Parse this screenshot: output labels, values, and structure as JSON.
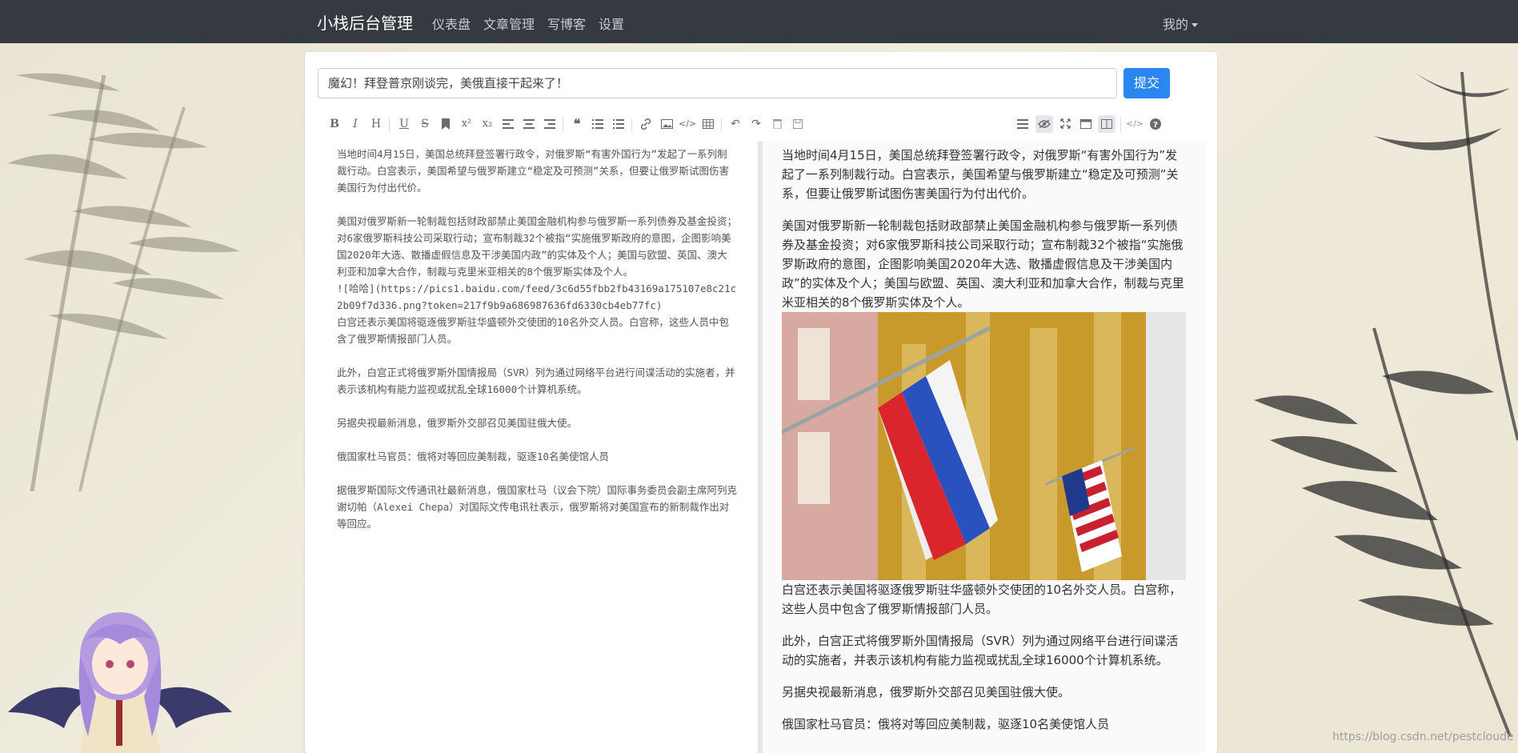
{
  "navbar": {
    "brand": "小栈后台管理",
    "links": [
      "仪表盘",
      "文章管理",
      "写博客",
      "设置"
    ],
    "user_menu": "我的"
  },
  "editor": {
    "title_value": "魔幻！拜登普京刚谈完，美俄直接干起来了！",
    "submit_label": "提交",
    "toolbar": {
      "left": [
        "bold-icon",
        "italic-icon",
        "heading-icon",
        "underline-icon",
        "strikethrough-icon",
        "bookmark-icon",
        "superscript-icon",
        "subscript-icon",
        "align-left-icon",
        "align-center-icon",
        "align-right-icon",
        "quote-icon",
        "ordered-list-icon",
        "unordered-list-icon",
        "link-icon",
        "image-icon",
        "code-icon",
        "table-icon",
        "undo-icon",
        "redo-icon",
        "trash-icon",
        "save-icon"
      ],
      "right": [
        "navigation-icon",
        "preview-toggle-icon",
        "fullscreen-icon",
        "window-icon",
        "split-view-icon",
        "html-code-icon",
        "help-icon"
      ]
    },
    "source": {
      "p1": "当地时间4月15日，美国总统拜登签署行政令，对俄罗斯“有害外国行为”发起了一系列制裁行动。白宫表示，美国希望与俄罗斯建立“稳定及可预测”关系，但要让俄罗斯试图伤害美国行为付出代价。",
      "p2": "美国对俄罗斯新一轮制裁包括财政部禁止美国金融机构参与俄罗斯一系列债券及基金投资；对6家俄罗斯科技公司采取行动；宣布制裁32个被指“实施俄罗斯政府的意图，企图影响美国2020年大选、散播虚假信息及干涉美国内政”的实体及个人；美国与欧盟、英国、澳大利亚和加拿大合作，制裁与克里米亚相关的8个俄罗斯实体及个人。",
      "p3": "![哈哈](https://pics1.baidu.com/feed/3c6d55fbb2fb43169a175107e8c21c2b09f7d336.png?token=217f9b9a686987636fd6330cb4eb77fc)",
      "p4": "白宫还表示美国将驱逐俄罗斯驻华盛顿外交使团的10名外交人员。白宫称，这些人员中包含了俄罗斯情报部门人员。",
      "p5": "此外，白宫正式将俄罗斯外国情报局（SVR）列为通过网络平台进行间谍活动的实施者，并表示该机构有能力监视或扰乱全球16000个计算机系统。",
      "p6": "另据央视最新消息，俄罗斯外交部召见美国驻俄大使。",
      "p7": "俄国家杜马官员：俄将对等回应美制裁，驱逐10名美使馆人员",
      "p8": "据俄罗斯国际文传通讯社最新消息，俄国家杜马（议会下院）国际事务委员会副主席阿列克谢切帕（Alexei Chepa）对国际文传电讯社表示，俄罗斯将对美国宣布的新制裁作出对等回应。"
    },
    "preview": {
      "p1": "当地时间4月15日，美国总统拜登签署行政令，对俄罗斯“有害外国行为”发起了一系列制裁行动。白宫表示，美国希望与俄罗斯建立“稳定及可预测”关系，但要让俄罗斯试图伤害美国行为付出代价。",
      "p2": "美国对俄罗斯新一轮制裁包括财政部禁止美国金融机构参与俄罗斯一系列债券及基金投资；对6家俄罗斯科技公司采取行动；宣布制裁32个被指“实施俄罗斯政府的意图，企图影响美国2020年大选、散播虚假信息及干涉美国内政”的实体及个人；美国与欧盟、英国、澳大利亚和加拿大合作，制裁与克里米亚相关的8个俄罗斯实体及个人。",
      "p4": "白宫还表示美国将驱逐俄罗斯驻华盛顿外交使团的10名外交人员。白宫称，这些人员中包含了俄罗斯情报部门人员。",
      "p5": "此外，白宫正式将俄罗斯外国情报局（SVR）列为通过网络平台进行间谍活动的实施者，并表示该机构有能力监视或扰乱全球16000个计算机系统。",
      "p6": "另据央视最新消息，俄罗斯外交部召见美国驻俄大使。",
      "p7": "俄国家杜马官员：俄将对等回应美制裁，驱逐10名美使馆人员"
    }
  },
  "watermark": "https://blog.csdn.net/pestcloude",
  "colors": {
    "navbar": "#343a40",
    "primary": "#2a86f0"
  }
}
